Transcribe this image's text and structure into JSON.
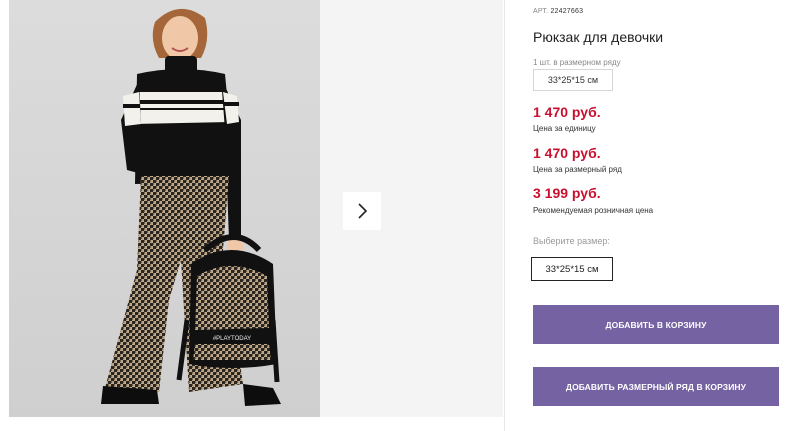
{
  "product": {
    "article_label": "АРТ.",
    "article": "22427663",
    "title": "Рюкзак для девочки",
    "row_qty": "1 шт. в размерном ряду",
    "row_size": "33*25*15 см"
  },
  "prices": [
    {
      "value": "1 470 руб.",
      "label": "Цена за единицу"
    },
    {
      "value": "1 470 руб.",
      "label": "Цена за размерный ряд"
    },
    {
      "value": "3 199 руб.",
      "label": "Рекомендуемая розничная цена"
    }
  ],
  "size_select": {
    "label": "Выберите размер:",
    "options": [
      "33*25*15 см"
    ]
  },
  "buttons": {
    "add_to_cart": "ДОБАВИТЬ В КОРЗИНУ",
    "add_row_to_cart": "ДОБАВИТЬ РАЗМЕРНЫЙ РЯД В КОРЗИНУ"
  },
  "backpack_brand": "#PLAYTODAY",
  "icons": {
    "next": "chevron-right-icon"
  },
  "colors": {
    "price": "#c8102e",
    "button": "#7562a3",
    "photo_bg": "#d9d9d9"
  }
}
